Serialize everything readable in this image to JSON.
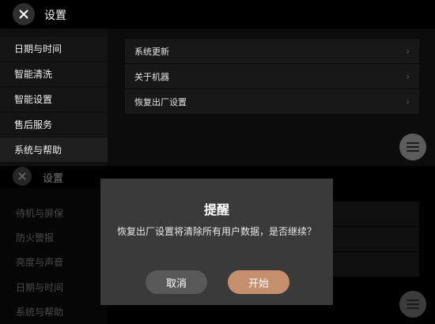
{
  "top": {
    "title": "设置",
    "sidebar": [
      "日期与时间",
      "智能清洗",
      "智能设置",
      "售后服务",
      "系统与帮助"
    ],
    "rows": [
      "系统更新",
      "关于机器",
      "恢复出厂设置"
    ],
    "chevron": "›"
  },
  "bottom": {
    "title": "设置",
    "sidebar": [
      "待机与屏保",
      "防火警报",
      "亮度与声音",
      "日期与时间",
      "系统与帮助"
    ]
  },
  "dialog": {
    "title": "提醒",
    "message": "恢复出厂设置将清除所有用户数据，是否继续？",
    "cancel": "取消",
    "confirm": "开始"
  },
  "colors": {
    "confirm_button": "#c58f6e",
    "cancel_button": "#595959",
    "dialog_bg": "#3a3a3a"
  },
  "icons": {
    "close": "close-icon",
    "menu": "menu-icon"
  }
}
